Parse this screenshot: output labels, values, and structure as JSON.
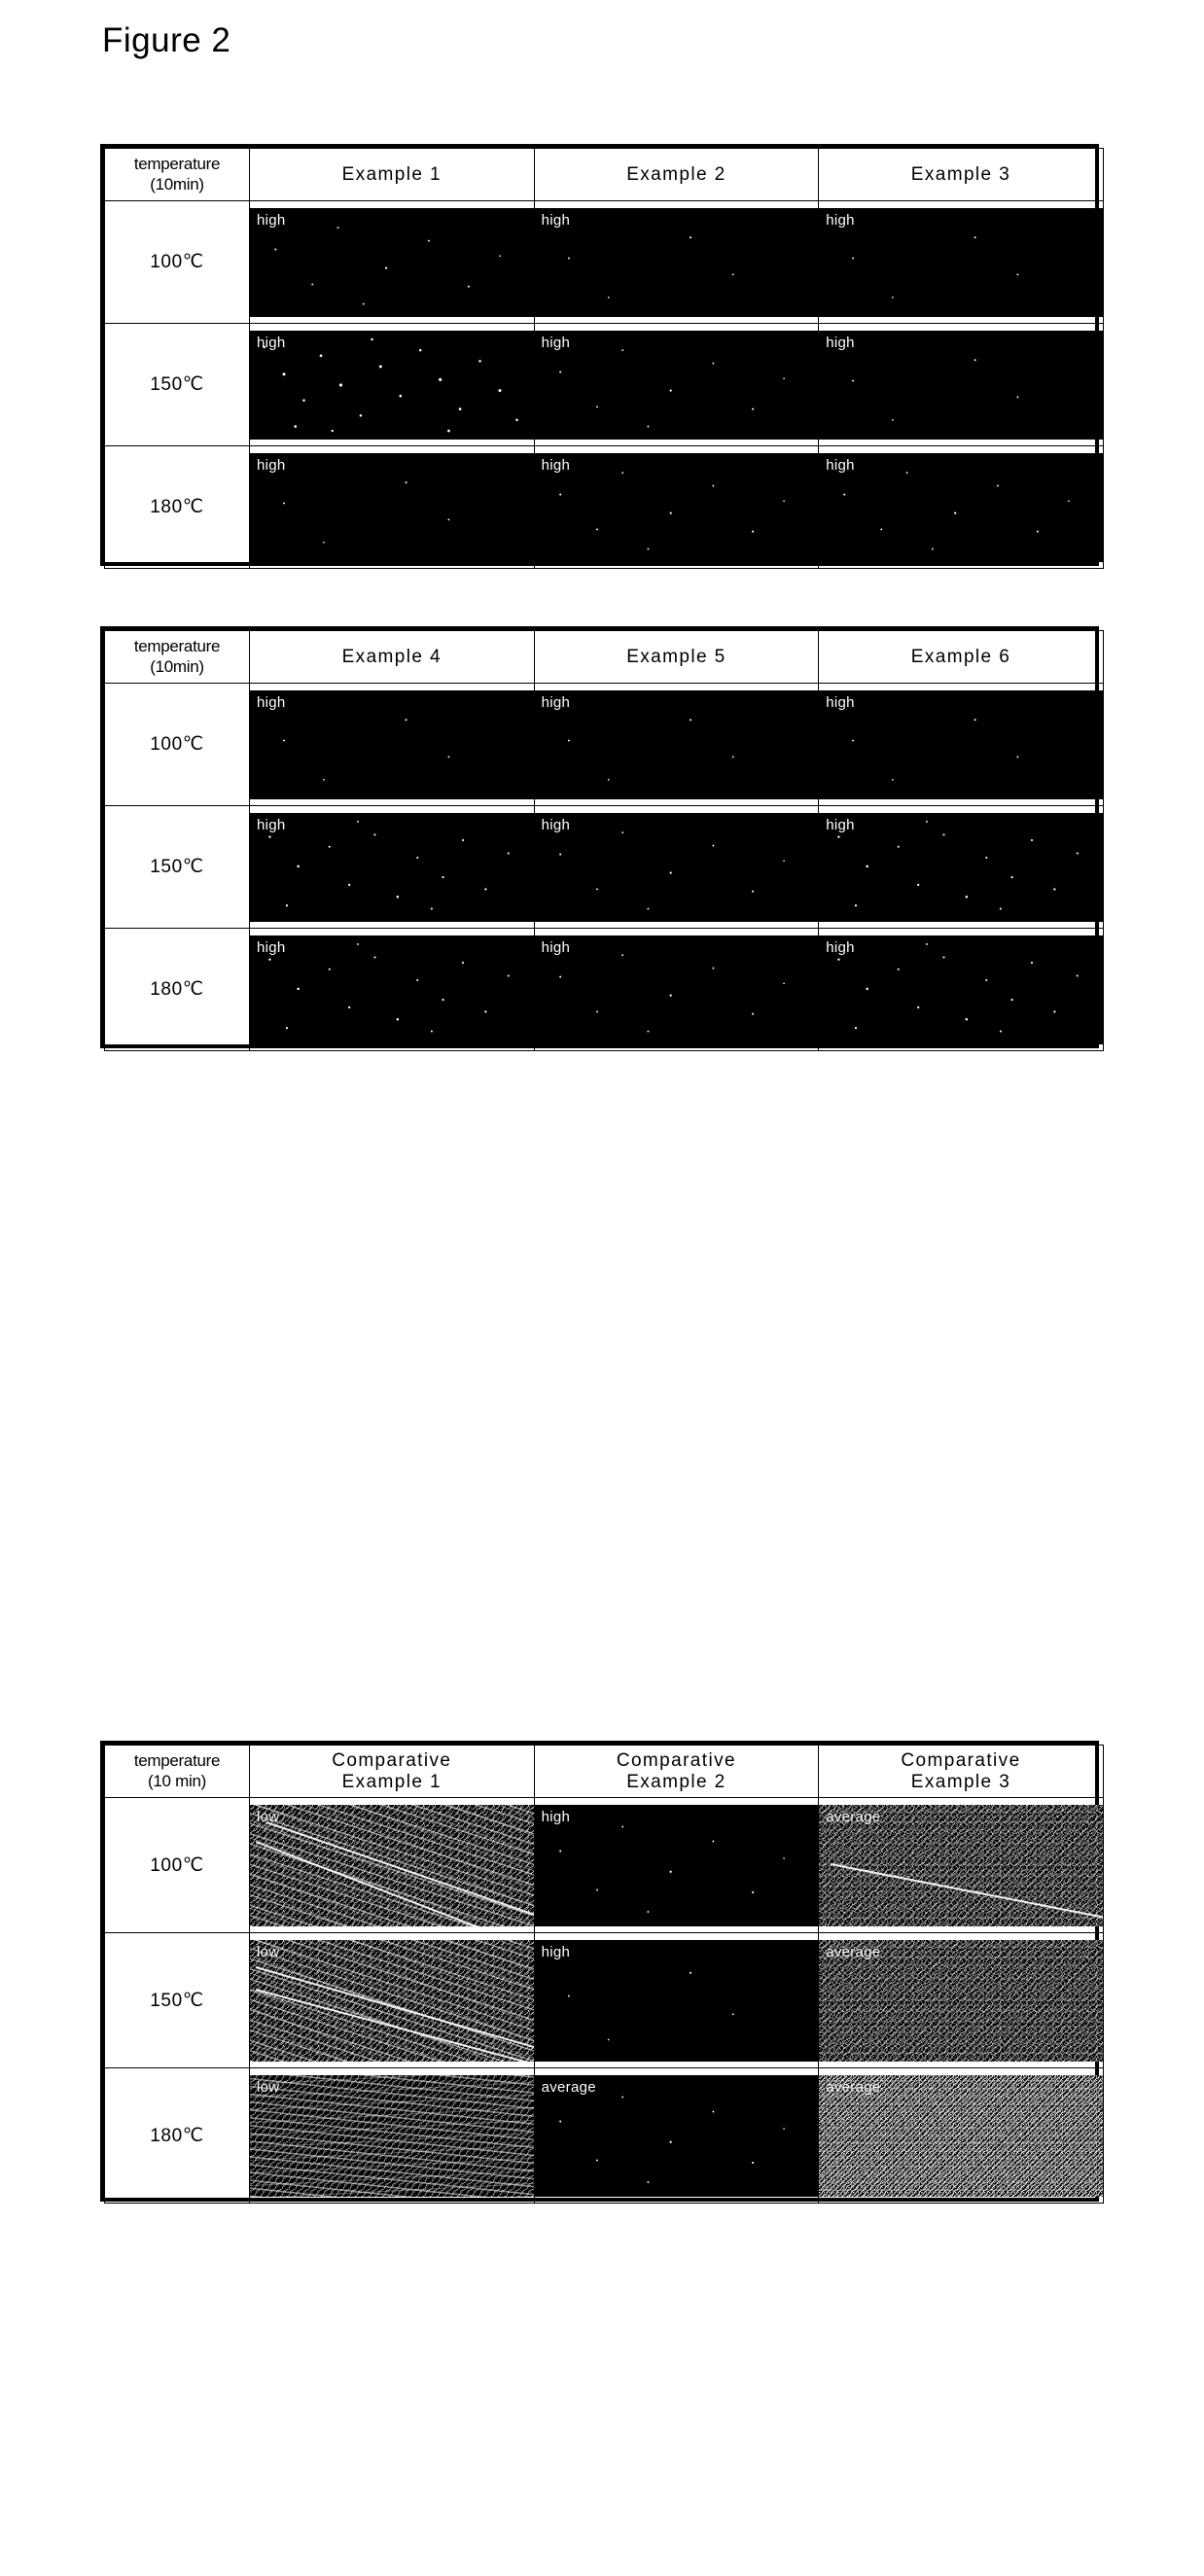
{
  "figure": {
    "title": "Figure 2"
  },
  "tables": [
    {
      "id": "table-1",
      "header": {
        "temperature_label_line1": "temperature",
        "temperature_label_line2": "(10min)",
        "columns": [
          "Example 1",
          "Example 2",
          "Example 3"
        ]
      },
      "rows": [
        {
          "temperature": "100℃",
          "cells": [
            {
              "tag": "high",
              "density": "d-low"
            },
            {
              "tag": "high",
              "density": "d-vlow"
            },
            {
              "tag": "high",
              "density": "d-vlow"
            }
          ]
        },
        {
          "temperature": "150℃",
          "cells": [
            {
              "tag": "high",
              "density": "d-high"
            },
            {
              "tag": "high",
              "density": "d-low"
            },
            {
              "tag": "high",
              "density": "d-vlow"
            }
          ]
        },
        {
          "temperature": "180℃",
          "cells": [
            {
              "tag": "high",
              "density": "d-vlow"
            },
            {
              "tag": "high",
              "density": "d-low"
            },
            {
              "tag": "high",
              "density": "d-low"
            }
          ]
        }
      ]
    },
    {
      "id": "table-2",
      "header": {
        "temperature_label_line1": "temperature",
        "temperature_label_line2": "(10min)",
        "columns": [
          "Example 4",
          "Example 5",
          "Example 6"
        ]
      },
      "rows": [
        {
          "temperature": "100℃",
          "cells": [
            {
              "tag": "high",
              "density": "d-vlow"
            },
            {
              "tag": "high",
              "density": "d-vlow"
            },
            {
              "tag": "high",
              "density": "d-vlow"
            }
          ]
        },
        {
          "temperature": "150℃",
          "cells": [
            {
              "tag": "high",
              "density": "d-med"
            },
            {
              "tag": "high",
              "density": "d-low"
            },
            {
              "tag": "high",
              "density": "d-med"
            }
          ]
        },
        {
          "temperature": "180℃",
          "cells": [
            {
              "tag": "high",
              "density": "d-med"
            },
            {
              "tag": "high",
              "density": "d-low"
            },
            {
              "tag": "high",
              "density": "d-med"
            }
          ]
        }
      ]
    },
    {
      "id": "table-3",
      "header": {
        "temperature_label_line1": "temperature",
        "temperature_label_line2": "(10 min)",
        "columns_line1": [
          "Comparative",
          "Comparative",
          "Comparative"
        ],
        "columns_line2": [
          "Example 1",
          "Example 2",
          "Example 3"
        ]
      },
      "rows": [
        {
          "temperature": "100℃",
          "cells": [
            {
              "tag": "low",
              "density": "d-grain-stripe"
            },
            {
              "tag": "high",
              "density": "d-low"
            },
            {
              "tag": "average",
              "density": "d-grain"
            }
          ]
        },
        {
          "temperature": "150℃",
          "cells": [
            {
              "tag": "low",
              "density": "d-grain-stripe"
            },
            {
              "tag": "high",
              "density": "d-vlow"
            },
            {
              "tag": "average",
              "density": "d-grain"
            }
          ]
        },
        {
          "temperature": "180℃",
          "cells": [
            {
              "tag": "low",
              "density": "d-grain-wave"
            },
            {
              "tag": "average",
              "density": "d-low"
            },
            {
              "tag": "average",
              "density": "d-grain-heavy"
            }
          ]
        }
      ]
    }
  ]
}
